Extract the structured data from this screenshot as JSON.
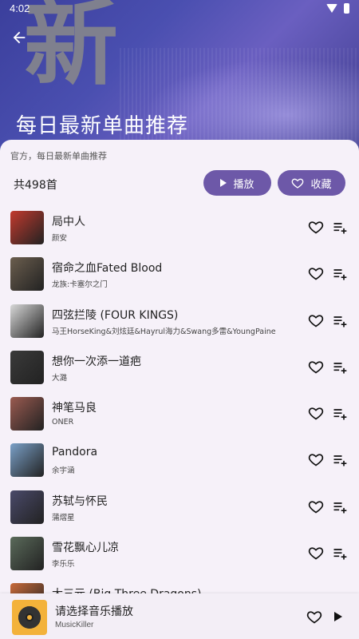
{
  "status": {
    "time": "4:02"
  },
  "header": {
    "big_char": "新",
    "title": "每日最新单曲推荐"
  },
  "playlist": {
    "description": "官方，每日最新单曲推荐",
    "count": "共498首",
    "play_label": "播放",
    "collect_label": "收藏"
  },
  "songs": [
    {
      "title": "局中人",
      "artist": "颜安",
      "cover": "#c23a2e"
    },
    {
      "title": "宿命之血Fated Blood",
      "artist": "龙族:卡塞尔之门",
      "cover": "#6b5e4e"
    },
    {
      "title": "四弦拦陵 (FOUR KINGS)",
      "artist": "马王HorseKing&刘炫廷&Hayrul海力&Swang多雷&YoungPaine",
      "cover": "#d8d8d8"
    },
    {
      "title": "想你一次添一道疤",
      "artist": "大潞",
      "cover": "#3a3a3a"
    },
    {
      "title": "神笔马良",
      "artist": "ONER",
      "cover": "#9a5a50"
    },
    {
      "title": "Pandora",
      "artist": "余宇涵",
      "cover": "#7aa0c8"
    },
    {
      "title": "苏轼与怀民",
      "artist": "蒲熠星",
      "cover": "#4a4a6a"
    },
    {
      "title": "雪花飘心儿凉",
      "artist": "李乐乐",
      "cover": "#5a6a5a"
    },
    {
      "title": "大三元 (Big Three Dragons)",
      "artist": "",
      "cover": "#c86a3a"
    }
  ],
  "player": {
    "title": "请选择音乐播放",
    "subtitle": "MusicKiller"
  },
  "colors": {
    "accent": "#6d58a8",
    "header": "#4a4fb0"
  }
}
